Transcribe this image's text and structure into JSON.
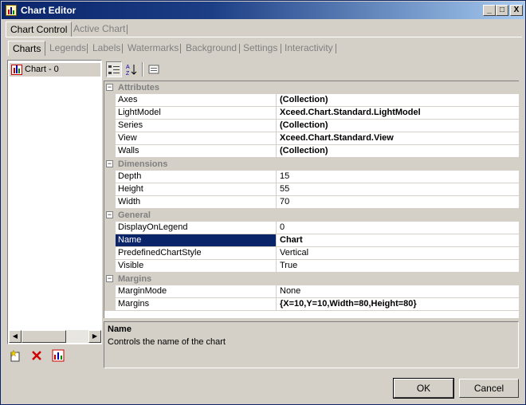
{
  "window": {
    "title": "Chart Editor",
    "controls": {
      "minimize": "_",
      "maximize": "□",
      "close": "X"
    }
  },
  "outer_tabs": [
    "Chart Control",
    "Active Chart"
  ],
  "inner_tabs": [
    "Charts",
    "Legends",
    "Labels",
    "Watermarks",
    "Background",
    "Settings",
    "Interactivity"
  ],
  "tree": {
    "items": [
      {
        "label": "Chart - 0",
        "icon": "bar-chart-icon"
      }
    ],
    "toolbar": [
      "new-item-icon",
      "delete-icon",
      "chart-wizard-icon"
    ]
  },
  "property_grid": {
    "toolbar": [
      "categorized-icon",
      "alphabetical-icon",
      "property-pages-icon"
    ],
    "categories": [
      {
        "name": "Attributes",
        "toggle": "−",
        "rows": [
          {
            "name": "Axes",
            "value": "(Collection)",
            "bold": true
          },
          {
            "name": "LightModel",
            "value": "Xceed.Chart.Standard.LightModel",
            "bold": true
          },
          {
            "name": "Series",
            "value": "(Collection)",
            "bold": true
          },
          {
            "name": "View",
            "value": "Xceed.Chart.Standard.View",
            "bold": true
          },
          {
            "name": "Walls",
            "value": "(Collection)",
            "bold": true
          }
        ]
      },
      {
        "name": "Dimensions",
        "toggle": "−",
        "rows": [
          {
            "name": "Depth",
            "value": "15",
            "bold": false
          },
          {
            "name": "Height",
            "value": "55",
            "bold": false
          },
          {
            "name": "Width",
            "value": "70",
            "bold": false
          }
        ]
      },
      {
        "name": "General",
        "toggle": "−",
        "rows": [
          {
            "name": "DisplayOnLegend",
            "value": "0",
            "bold": false
          },
          {
            "name": "Name",
            "value": "Chart",
            "bold": true,
            "selected": true
          },
          {
            "name": "PredefinedChartStyle",
            "value": "Vertical",
            "bold": false
          },
          {
            "name": "Visible",
            "value": "True",
            "bold": false
          }
        ]
      },
      {
        "name": "Margins",
        "toggle": "−",
        "rows": [
          {
            "name": "MarginMode",
            "value": "None",
            "bold": false
          },
          {
            "name": "Margins",
            "value": "{X=10,Y=10,Width=80,Height=80}",
            "bold": true
          }
        ]
      }
    ],
    "help": {
      "title": "Name",
      "description": "Controls the name of the chart"
    }
  },
  "buttons": {
    "ok": "OK",
    "cancel": "Cancel"
  },
  "colors": {
    "title_bar": "#0a246a",
    "selection": "#0a246a",
    "face": "#d4d0c8"
  }
}
